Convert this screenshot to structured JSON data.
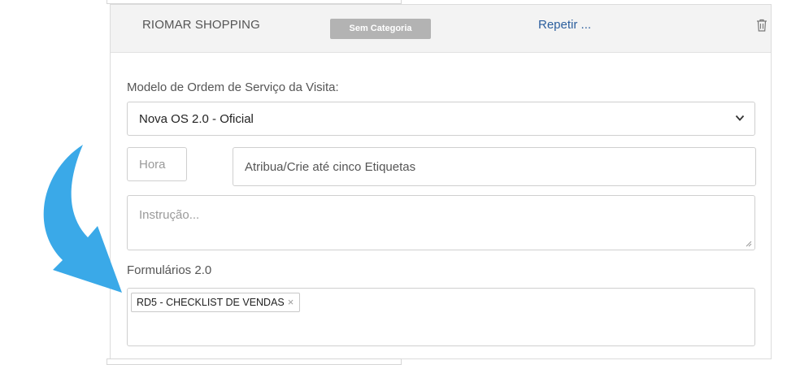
{
  "card": {
    "title": "RIOMAR SHOPPING",
    "badge": "Sem Categoria",
    "repeat_link": "Repetir ...",
    "trash_icon": "trash-icon"
  },
  "form": {
    "model_label": "Modelo de Ordem de Serviço da Visita:",
    "model_value": "Nova OS 2.0 - Oficial",
    "hora_placeholder": "Hora",
    "tags_placeholder": "Atribua/Crie até cinco Etiquetas",
    "instruction_placeholder": "Instrução...",
    "forms_label": "Formulários 2.0",
    "forms_items": [
      {
        "label": "RD5 - CHECKLIST DE VENDAS",
        "remove": "×"
      }
    ]
  },
  "colors": {
    "arrow": "#3aa9e8",
    "link": "#2c5f9e",
    "badge_bg": "#b3b3b3"
  }
}
